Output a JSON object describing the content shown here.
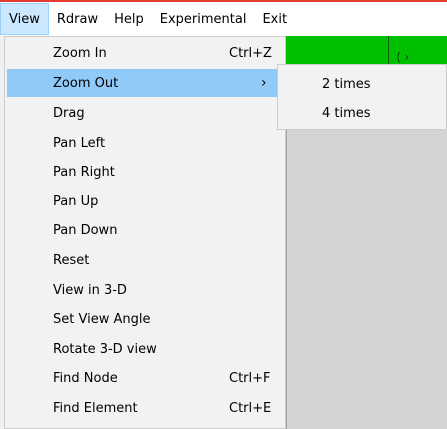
{
  "menubar": {
    "items": [
      "View",
      "Rdraw",
      "Help",
      "Experimental",
      "Exit"
    ]
  },
  "view_menu": {
    "items": [
      {
        "label": "Zoom In",
        "shortcut": "Ctrl+Z"
      },
      {
        "label": "Zoom Out",
        "submenu_arrow": "›"
      },
      {
        "label": "Drag"
      },
      {
        "label": "Pan Left"
      },
      {
        "label": "Pan Right"
      },
      {
        "label": "Pan Up"
      },
      {
        "label": "Pan Down"
      },
      {
        "label": "Reset"
      },
      {
        "label": "View in 3-D"
      },
      {
        "label": "Set View Angle"
      },
      {
        "label": "Rotate 3-D view"
      },
      {
        "label": "Find Node",
        "shortcut": "Ctrl+F"
      },
      {
        "label": "Find Element",
        "shortcut": "Ctrl+E"
      }
    ]
  },
  "zoom_out_submenu": {
    "items": [
      "2 times",
      "4 times"
    ]
  },
  "canvas": {
    "marker_text": "⟨ ›"
  },
  "colors": {
    "highlight": "#91c9f7",
    "menubar_active": "#cce8ff",
    "green_strip": "#00c000",
    "top_accent": "#e03c31"
  }
}
